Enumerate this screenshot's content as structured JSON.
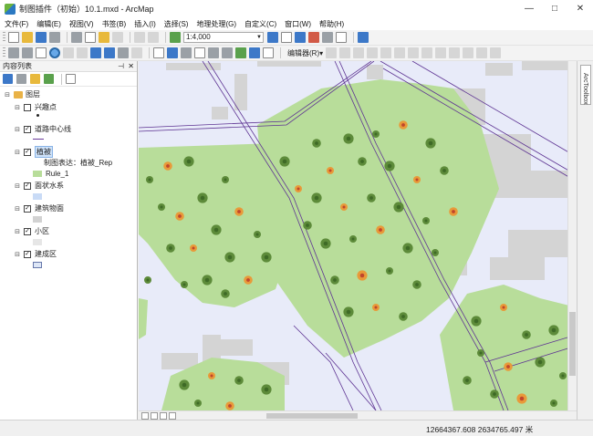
{
  "window": {
    "title": "制图插件（初始）10.1.mxd - ArcMap",
    "minimize": "—",
    "maximize": "□",
    "close": "✕"
  },
  "menu": [
    "文件(F)",
    "编辑(E)",
    "视图(V)",
    "书签(B)",
    "插入(I)",
    "选择(S)",
    "地理处理(G)",
    "自定义(C)",
    "窗口(W)",
    "帮助(H)"
  ],
  "toolbar": {
    "scale": "1:4,000",
    "editor_label": "编辑器(R)▾"
  },
  "toc": {
    "title": "内容列表",
    "pin": "⊣",
    "close": "✕",
    "root": "图层",
    "layers": [
      {
        "name": "兴趣点",
        "checked": false
      },
      {
        "name": "道路中心线",
        "checked": true
      },
      {
        "name": "植被",
        "checked": true,
        "highlighted": true,
        "rep": "制图表达：植被_Rep",
        "rule": "Rule_1"
      },
      {
        "name": "面状水系",
        "checked": true
      },
      {
        "name": "建筑物面",
        "checked": true
      },
      {
        "name": "小区",
        "checked": true
      },
      {
        "name": "建成区",
        "checked": true
      }
    ]
  },
  "right_dock": {
    "tab": "ArcToolbox"
  },
  "status": {
    "coordinates": "12664367.608   2634765.497 米"
  },
  "colors": {
    "vegetation": "#b8dd9a",
    "water": "#c9dbf6",
    "building": "#d2d2d2",
    "road": "#6a3a9a",
    "tree_green": "#5d8b3a",
    "tree_orange": "#e89a3a"
  }
}
